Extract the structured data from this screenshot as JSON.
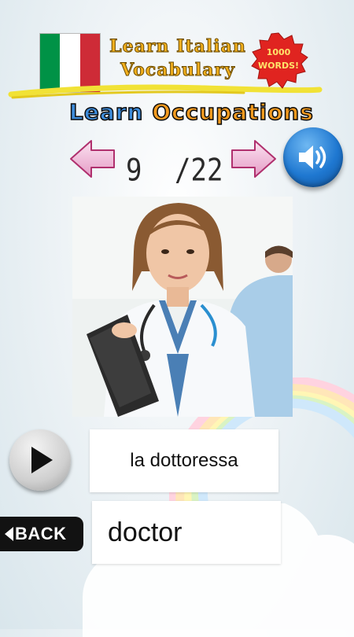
{
  "header": {
    "app_title_line1": "Learn Italian",
    "app_title_line2": "Vocabulary",
    "badge_line1": "1000",
    "badge_line2": "WORDS!",
    "section_word1": "Learn",
    "section_word2": "Occupations"
  },
  "flag_colors": [
    "#009246",
    "#ffffff",
    "#ce2b37"
  ],
  "navigation": {
    "current": "9",
    "total": "/22",
    "prev_icon": "left-arrow-icon",
    "next_icon": "right-arrow-icon",
    "sound_icon": "speaker-icon"
  },
  "card": {
    "italian_word": "la dottoressa",
    "english_word": "doctor",
    "back_label": "BACK",
    "play_icon": "play-icon"
  },
  "colors": {
    "title_gold": "#f2b01e",
    "section_blue": "#3d8bd9",
    "section_orange": "#f29a1f",
    "arrow_pink": "#e8a6cc",
    "sound_blue": "#1f78d1"
  }
}
